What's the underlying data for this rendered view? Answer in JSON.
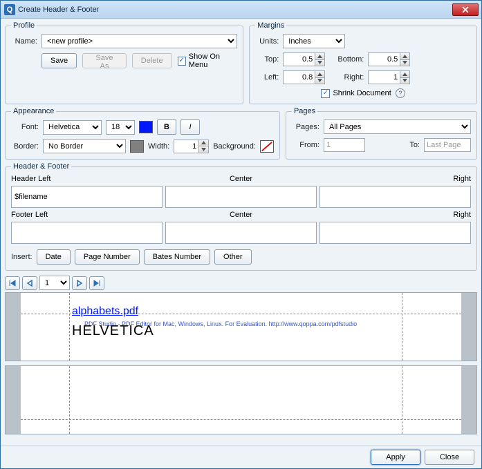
{
  "window": {
    "title": "Create Header & Footer"
  },
  "profile": {
    "legend": "Profile",
    "name_label": "Name:",
    "name_value": "<new profile>",
    "save": "Save",
    "save_as": "Save As",
    "delete": "Delete",
    "show_on_menu": "Show On Menu",
    "show_on_menu_checked": true
  },
  "margins": {
    "legend": "Margins",
    "units_label": "Units:",
    "units_value": "Inches",
    "top_label": "Top:",
    "top_value": "0.5",
    "bottom_label": "Bottom:",
    "bottom_value": "0.5",
    "left_label": "Left:",
    "left_value": "0.8",
    "right_label": "Right:",
    "right_value": "1",
    "shrink_label": "Shrink Document",
    "shrink_checked": true
  },
  "appearance": {
    "legend": "Appearance",
    "font_label": "Font:",
    "font_value": "Helvetica",
    "size_value": "18",
    "font_color": "#0018ff",
    "bold": "B",
    "italic": "I",
    "border_label": "Border:",
    "border_value": "No Border",
    "border_color": "#808080",
    "width_label": "Width:",
    "width_value": "1",
    "background_label": "Background:",
    "background_none_icon": "no-fill-icon"
  },
  "pages": {
    "legend": "Pages",
    "pages_label": "Pages:",
    "pages_value": "All Pages",
    "from_label": "From:",
    "from_value": "1",
    "to_label": "To:",
    "to_value": "Last Page"
  },
  "hf": {
    "legend": "Header & Footer",
    "header_left_label": "Header Left",
    "center_label": "Center",
    "right_label": "Right",
    "footer_left_label": "Footer Left",
    "header_left_value": "$filename",
    "header_center_value": "",
    "header_right_value": "",
    "footer_left_value": "",
    "footer_center_value": "",
    "footer_right_value": ""
  },
  "insert": {
    "label": "Insert:",
    "date": "Date",
    "page_number": "Page Number",
    "bates": "Bates Number",
    "other": "Other"
  },
  "nav": {
    "page_value": "1"
  },
  "preview": {
    "filename_text": "alphabets.pdf",
    "filename_color": "#0018ff",
    "eval_text": "PDF Studio - PDF Editor for Mac, Windows, Linux. For Evaluation. http://www.qoppa.com/pdfstudio",
    "helvetica_text": "HELVETICA"
  },
  "footer": {
    "apply": "Apply",
    "close": "Close"
  }
}
